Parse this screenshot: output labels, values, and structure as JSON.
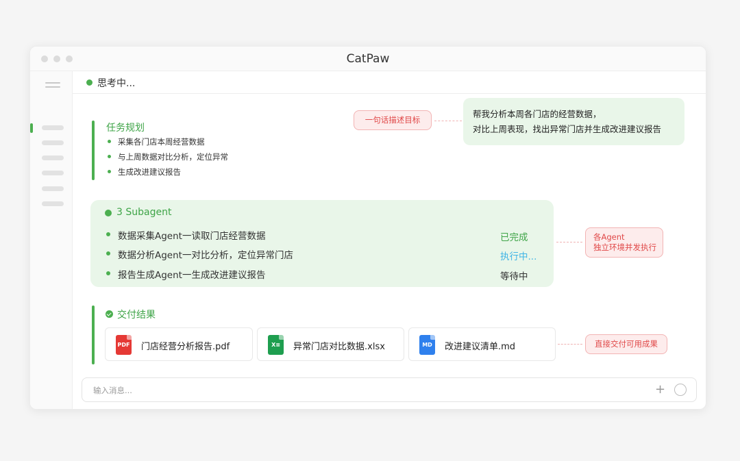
{
  "app": {
    "title": "CatPaw"
  },
  "status": {
    "text": "思考中..."
  },
  "colors": {
    "accent": "#4caf50",
    "running": "#3fb4e6",
    "callout_red": "#e04848"
  },
  "plan": {
    "title": "任务规划",
    "items": [
      "采集各门店本周经营数据",
      "与上周数据对比分析，定位异常",
      "生成改进建议报告"
    ]
  },
  "user_message": {
    "line1": "帮我分析本周各门店的经营数据，",
    "line2": "对比上周表现，找出异常门店并生成改进建议报告"
  },
  "callouts": {
    "goal": "一句话描述目标",
    "agents_line1": "各Agent",
    "agents_line2": "独立环境并发执行",
    "delivery": "直接交付可用成果"
  },
  "subagents": {
    "title": "3 Subagent",
    "rows": [
      {
        "label": "数据采集Agent一读取门店经营数据",
        "status": "已完成",
        "status_color": "#3ea447"
      },
      {
        "label": "数据分析Agent一对比分析，定位异常门店",
        "status": "执行中...",
        "status_color": "#3fb4e6"
      },
      {
        "label": "报告生成Agent一生成改进建议报告",
        "status": "等待中",
        "status_color": "#333333"
      }
    ]
  },
  "results": {
    "title": "交付结果",
    "files": [
      {
        "name": "门店经营分析报告.pdf",
        "icon_label": "PDF",
        "icon": "pdf-file-icon",
        "color": "#e53935"
      },
      {
        "name": "异常门店对比数据.xlsx",
        "icon_label": "X≡",
        "icon": "excel-file-icon",
        "color": "#1e9e4f"
      },
      {
        "name": "改进建议清单.md",
        "icon_label": "MD",
        "icon": "markdown-file-icon",
        "color": "#2f80ed"
      }
    ]
  },
  "input": {
    "placeholder": "输入消息...",
    "plus": "+"
  }
}
